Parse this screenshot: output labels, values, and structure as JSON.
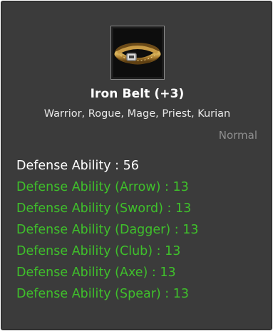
{
  "item": {
    "name": "Iron Belt (+3)",
    "icon": "iron-belt-icon",
    "classes": "Warrior, Rogue, Mage, Priest, Kurian",
    "rarity": "Normal"
  },
  "stats": {
    "main": "Defense Ability : 56",
    "sub": [
      "Defense Ability (Arrow) : 13",
      "Defense Ability (Sword) : 13",
      "Defense Ability (Dagger) : 13",
      "Defense Ability (Club) : 13",
      "Defense Ability (Axe) : 13",
      "Defense Ability (Spear) : 13"
    ]
  },
  "colors": {
    "background": "#3b3b3b",
    "main_stat": "#ffffff",
    "sub_stat": "#3fc02b",
    "rarity": "#8f8f8f"
  }
}
